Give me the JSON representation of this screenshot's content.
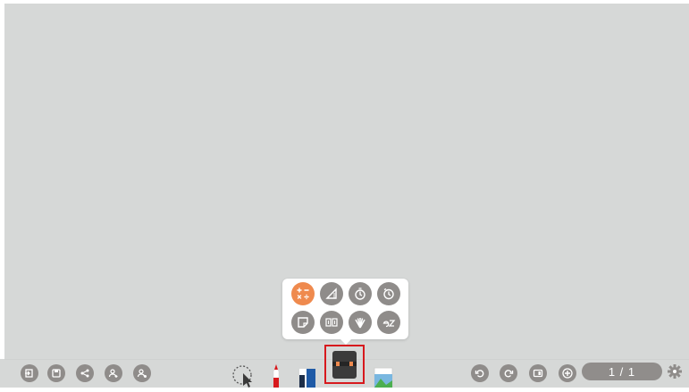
{
  "page_indicator": "1 / 1",
  "colors": {
    "canvas": "#d6d8d7",
    "icon_gray": "#8f8c8a",
    "active_orange": "#ef8a4e",
    "highlight_red": "#d7191d"
  },
  "left_tools": [
    {
      "name": "exit-icon"
    },
    {
      "name": "save-icon"
    },
    {
      "name": "share-icon"
    },
    {
      "name": "add-user-icon"
    },
    {
      "name": "user-settings-icon"
    }
  ],
  "center_tools": [
    {
      "name": "lasso-select-tool"
    },
    {
      "name": "pen-tool"
    },
    {
      "name": "eraser-tool"
    },
    {
      "name": "toolbox-tool",
      "selected": true
    },
    {
      "name": "insert-image-tool"
    }
  ],
  "right_tools": [
    {
      "name": "undo-icon"
    },
    {
      "name": "redo-icon"
    },
    {
      "name": "page-view-icon"
    },
    {
      "name": "add-page-icon"
    }
  ],
  "toolbox_popup": {
    "row1": [
      {
        "name": "calculator-icon",
        "active": true
      },
      {
        "name": "ruler-icon"
      },
      {
        "name": "stopwatch-icon"
      },
      {
        "name": "timer-icon"
      }
    ],
    "row2": [
      {
        "name": "sticky-note-icon"
      },
      {
        "name": "flashcard-icon"
      },
      {
        "name": "lottery-icon"
      },
      {
        "name": "ez-icon"
      }
    ]
  }
}
